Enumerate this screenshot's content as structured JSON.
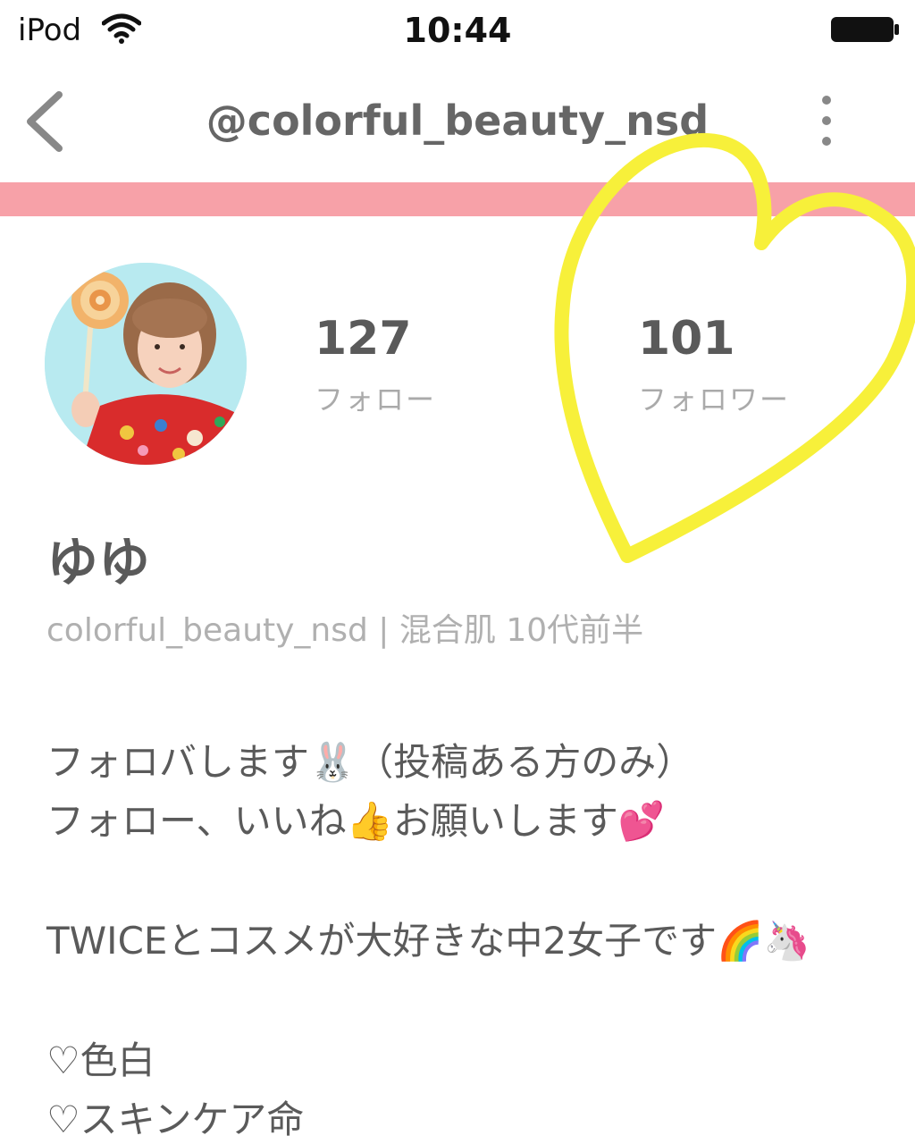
{
  "status_bar": {
    "carrier": "iPod",
    "time": "10:44"
  },
  "nav": {
    "title": "@colorful_beauty_nsd"
  },
  "profile": {
    "following_count": "127",
    "following_label": "フォロー",
    "followers_count": "101",
    "followers_label": "フォロワー",
    "display_name": "ゆゆ",
    "meta": "colorful_beauty_nsd | 混合肌  10代前半"
  },
  "bio": {
    "line1": "フォロバします🐰（投稿ある方のみ）",
    "line2": "フォロー、いいね👍お願いします💕",
    "line3": "TWICEとコスメが大好きな中2女子です🌈🦄",
    "line4": "♡色白",
    "line5": "♡スキンケア命"
  },
  "colors": {
    "accent_bar": "#f7a1a8",
    "heart_doodle": "#f7f03a"
  },
  "icons": [
    "wifi-icon",
    "battery-icon",
    "back-icon",
    "more-icon",
    "heart-doodle"
  ]
}
